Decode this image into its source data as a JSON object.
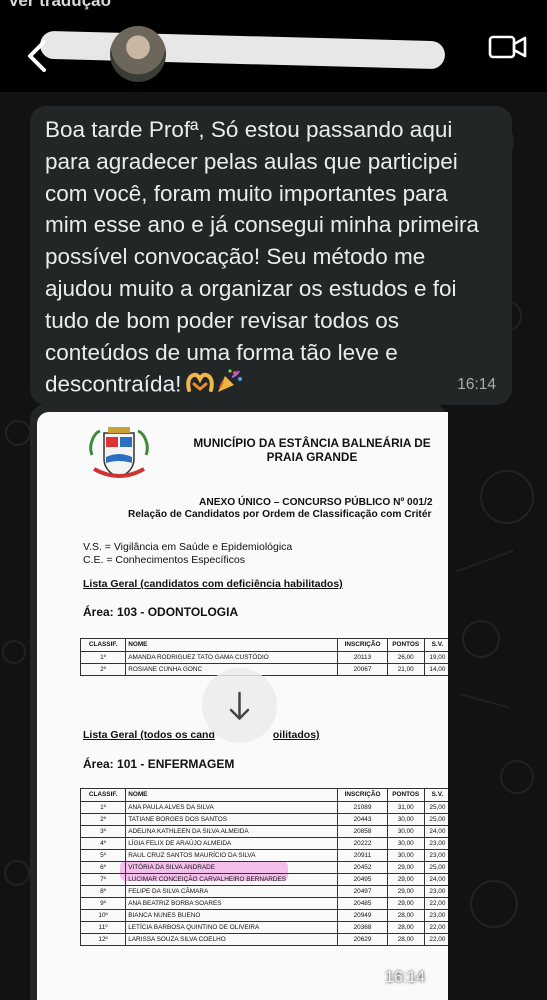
{
  "top": {
    "label": "Ver tradução"
  },
  "header": {
    "contact_name": "   "
  },
  "message": {
    "text": "Boa tarde Profª, Só estou passando aqui para agradecer pelas aulas que participei com você, foram muito importantes para mim esse ano e já consegui minha primeira possível convocação! Seu método me ajudou muito a organizar os estudos e foi tudo de bom poder revisar todos os conteúdos de uma forma tão leve e descontraída!",
    "emojis": [
      "heart-hands-emoji",
      "party-popper-emoji"
    ],
    "time": "16:14"
  },
  "image_message": {
    "time": "16:14",
    "doc": {
      "title": "MUNICÍPIO DA ESTÂNCIA BALNEÁRIA DE PRAIA GRANDE",
      "anexo": "ANEXO ÚNICO – CONCURSO PÚBLICO Nº 001/2",
      "relacao": "Relação de Candidatos por Ordem de Classificação com Critér",
      "legend_vs": "V.S. = Vigilância em Saúde e Epidemiológica",
      "legend_ce": "C.E. = Conhecimentos Específicos",
      "lista1": "Lista Geral (candidatos com deficiência habilitados)",
      "area1": "Área: 103 - ODONTOLOGIA",
      "lista2": "Lista Geral (todos os cand",
      "lista2_tail": "oilitados)",
      "area2": "Área: 101 - ENFERMAGEM",
      "headers": [
        "CLASSIF.",
        "NOME",
        "INSCRIÇÃO",
        "PONTOS",
        "S.V."
      ],
      "table1": [
        [
          "1º",
          "AMANDA RODRIGUEZ TATO GAMA CUSTÓDIO",
          "20113",
          "26,00",
          "19,00"
        ],
        [
          "2º",
          "ROSIANE CUNHA GONC",
          "20067",
          "21,00",
          "14,00"
        ]
      ],
      "table2": [
        [
          "1º",
          "ANA PAULA ALVES DA SILVA",
          "21089",
          "31,00",
          "25,00"
        ],
        [
          "2º",
          "TATIANE BORGES DOS SANTOS",
          "20443",
          "30,00",
          "25,00"
        ],
        [
          "3º",
          "ADELINA KATHLEEN DA SILVA ALMEIDA",
          "20858",
          "30,00",
          "24,00"
        ],
        [
          "4º",
          "LÍGIA FELIX DE ARAÚJO ALMEIDA",
          "20222",
          "30,00",
          "23,00"
        ],
        [
          "5º",
          "RAUL CRUZ SANTOS MAURÍCIO DA SILVA",
          "20911",
          "30,00",
          "23,00"
        ],
        [
          "6º",
          "VITÓRIA DA SILVA ANDRADE",
          "20452",
          "29,00",
          "25,00"
        ],
        [
          "7º",
          "LUCIMAR CONCEIÇÃO CARVALHEIRO BERNARDES",
          "20495",
          "29,00",
          "24,00"
        ],
        [
          "8º",
          "FELIPE DA SILVA CÂMARA",
          "20497",
          "29,00",
          "23,00"
        ],
        [
          "9º",
          "ANA BEATRIZ BORBA SOARES",
          "20485",
          "29,00",
          "22,00"
        ],
        [
          "10º",
          "BIANCA NUNES BUENO",
          "20949",
          "28,00",
          "23,00"
        ],
        [
          "11º",
          "LETÍCIA BARBOSA QUINTINO DE OLIVEIRA",
          "20368",
          "28,00",
          "22,00"
        ],
        [
          "12º",
          "LARISSA SOUZA SILVA COELHO",
          "20629",
          "28,00",
          "22,00"
        ]
      ]
    }
  },
  "colors": {
    "bubble": "#232626",
    "background": "#111313",
    "highlight": "#ec8cdd"
  }
}
